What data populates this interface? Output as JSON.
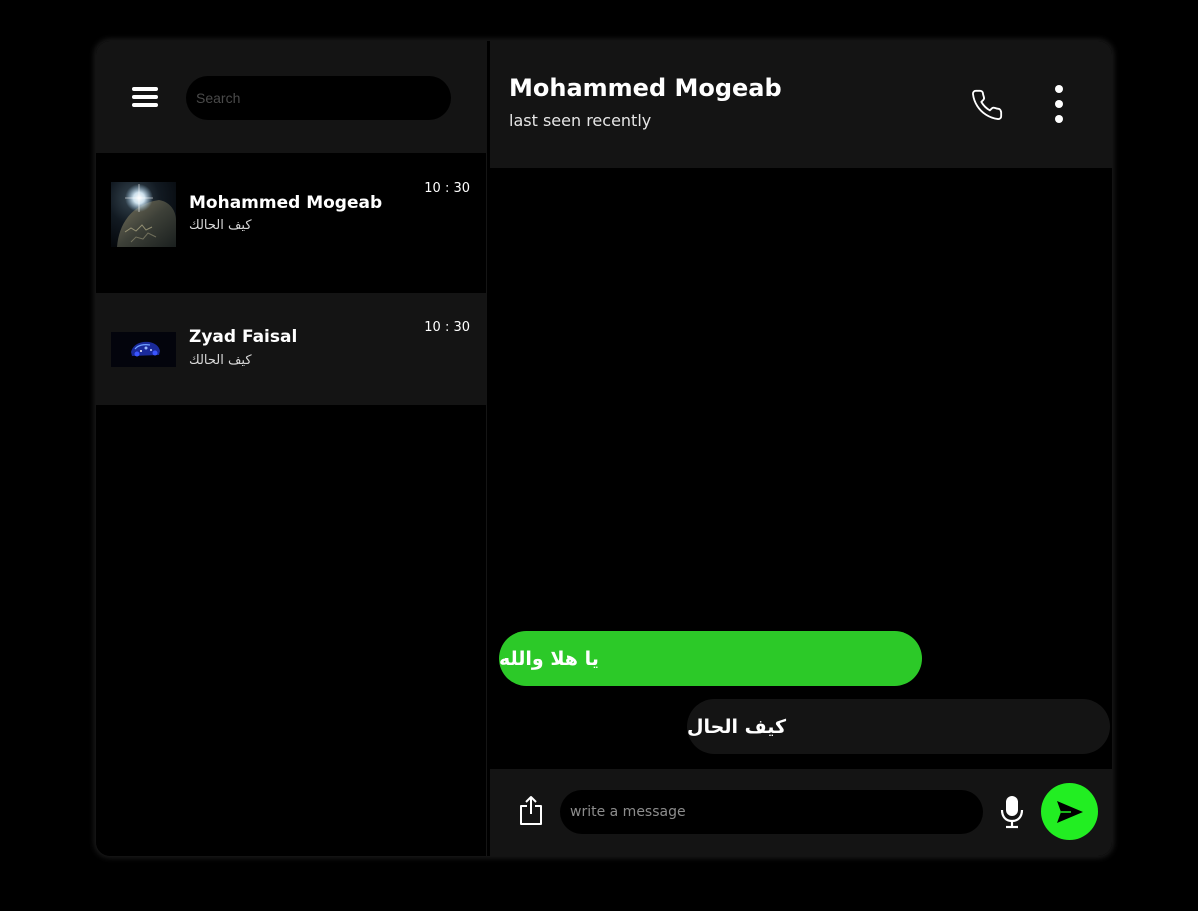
{
  "sidebar": {
    "search_placeholder": "Search",
    "chats": [
      {
        "name": "Mohammed Mogeab",
        "preview": "كيف الحالك",
        "time": "10 : 30",
        "avatar": "planet-photo-avatar"
      },
      {
        "name": "Zyad Faisal",
        "preview": "كيف الحالك",
        "time": "10 : 30",
        "avatar": "dark-blue-car-avatar"
      }
    ]
  },
  "conversation": {
    "contact_name": "Mohammed Mogeab",
    "status": "last seen recently",
    "messages": [
      {
        "direction": "sent",
        "text": "يا هلا والله"
      },
      {
        "direction": "received",
        "text": "كيف الحال"
      }
    ],
    "composer": {
      "placeholder": "write a message"
    }
  },
  "icons": {
    "menu": "hamburger-menu-icon",
    "call": "phone-icon",
    "more": "vertical-dots-icon",
    "share": "share-upload-icon",
    "mic": "microphone-icon",
    "send": "send-arrow-icon"
  },
  "colors": {
    "background": "#000000",
    "panel": "#141414",
    "sent_bubble": "#2cc928",
    "send_button": "#22ee22",
    "text": "#ffffff"
  }
}
